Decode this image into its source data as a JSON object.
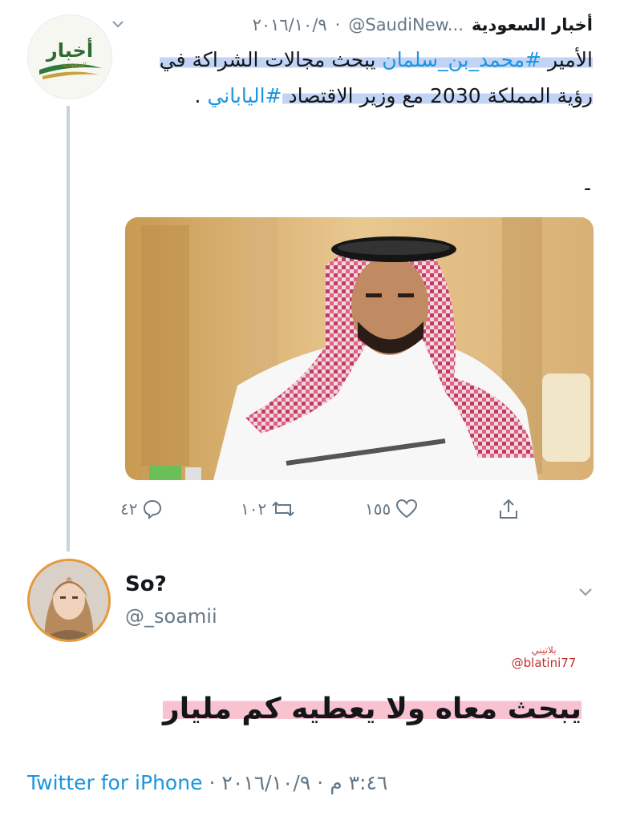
{
  "quoted_tweet": {
    "avatar_text": "أخبار",
    "avatar_subtext": "السعودية",
    "author_name": "أخبار السعودية",
    "author_handle": "@SaudiNew...",
    "separator": "·",
    "date": "٢٠١٦/١٠/٩",
    "body_part1": "الأمير ",
    "hashtag1": "#محمد_بن_سلمان",
    "body_part2": " يبحث مجالات الشراكة في رؤية المملكة 2030 مع وزير الاقتصاد ",
    "hashtag2": "#الياباني",
    "body_part3": " .",
    "dash": "-",
    "actions": {
      "reply_count": "٤٢",
      "retweet_count": "١٠٢",
      "like_count": "١٥٥"
    }
  },
  "reply_tweet": {
    "author_name": "So?",
    "author_handle": "@_soamii",
    "body": "يبحث معاه ولا يعطيه كم مليار",
    "timestamp": "٣:٤٦ م",
    "separator": "·",
    "date": "٢٠١٦/١٠/٩",
    "source_app": "Twitter for iPhone"
  },
  "watermark": {
    "arabic": "بلاتيني",
    "handle": "@blatini77"
  },
  "colors": {
    "link": "#1b95e0",
    "secondary_text": "#657786",
    "thread_line": "#c9d3da",
    "highlight_blue": "#78a0eb",
    "highlight_pink": "#f07896",
    "avatar_ring": "#e59a3b"
  }
}
